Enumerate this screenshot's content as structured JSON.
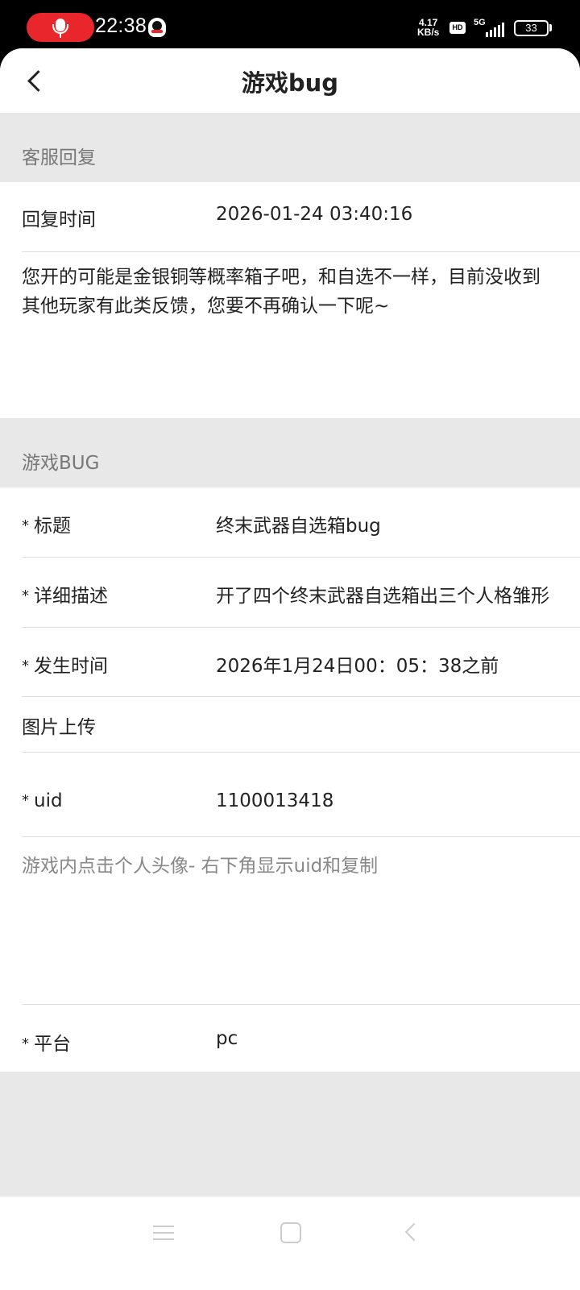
{
  "status_bar": {
    "time": "22:38",
    "net_speed_value": "4.17",
    "net_speed_unit": "KB/s",
    "hd_label": "HD",
    "network_type": "5G",
    "battery": "33",
    "icons": [
      "microphone-icon",
      "qq-icon",
      "hd-icon",
      "signal-icon",
      "battery-icon"
    ]
  },
  "header": {
    "title": "游戏bug",
    "back_icon": "chevron-left-icon"
  },
  "reply_section": {
    "header": "客服回复",
    "time_label": "回复时间",
    "time_value": "2026-01-24 03:40:16",
    "reply_text": "您开的可能是金银铜等概率箱子吧，和自选不一样，目前没收到其他玩家有此类反馈，您要不再确认一下呢~"
  },
  "bug_section": {
    "header": "游戏BUG",
    "required_marker": "*",
    "title_label": "标题",
    "title_value": "终末武器自选箱bug",
    "desc_label": "详细描述",
    "desc_value": "开了四个终末武器自选箱出三个人格雏形",
    "time_label": "发生时间",
    "time_value": "2026年1月24日00：05：38之前",
    "image_label": "图片上传",
    "uid_label": "uid",
    "uid_value": "1100013418",
    "uid_hint": "游戏内点击个人头像- 右下角显示uid和复制",
    "platform_label": "平台",
    "platform_value": "pc"
  },
  "nav_bar": {
    "icons": [
      "menu-icon",
      "home-icon",
      "back-icon"
    ]
  }
}
